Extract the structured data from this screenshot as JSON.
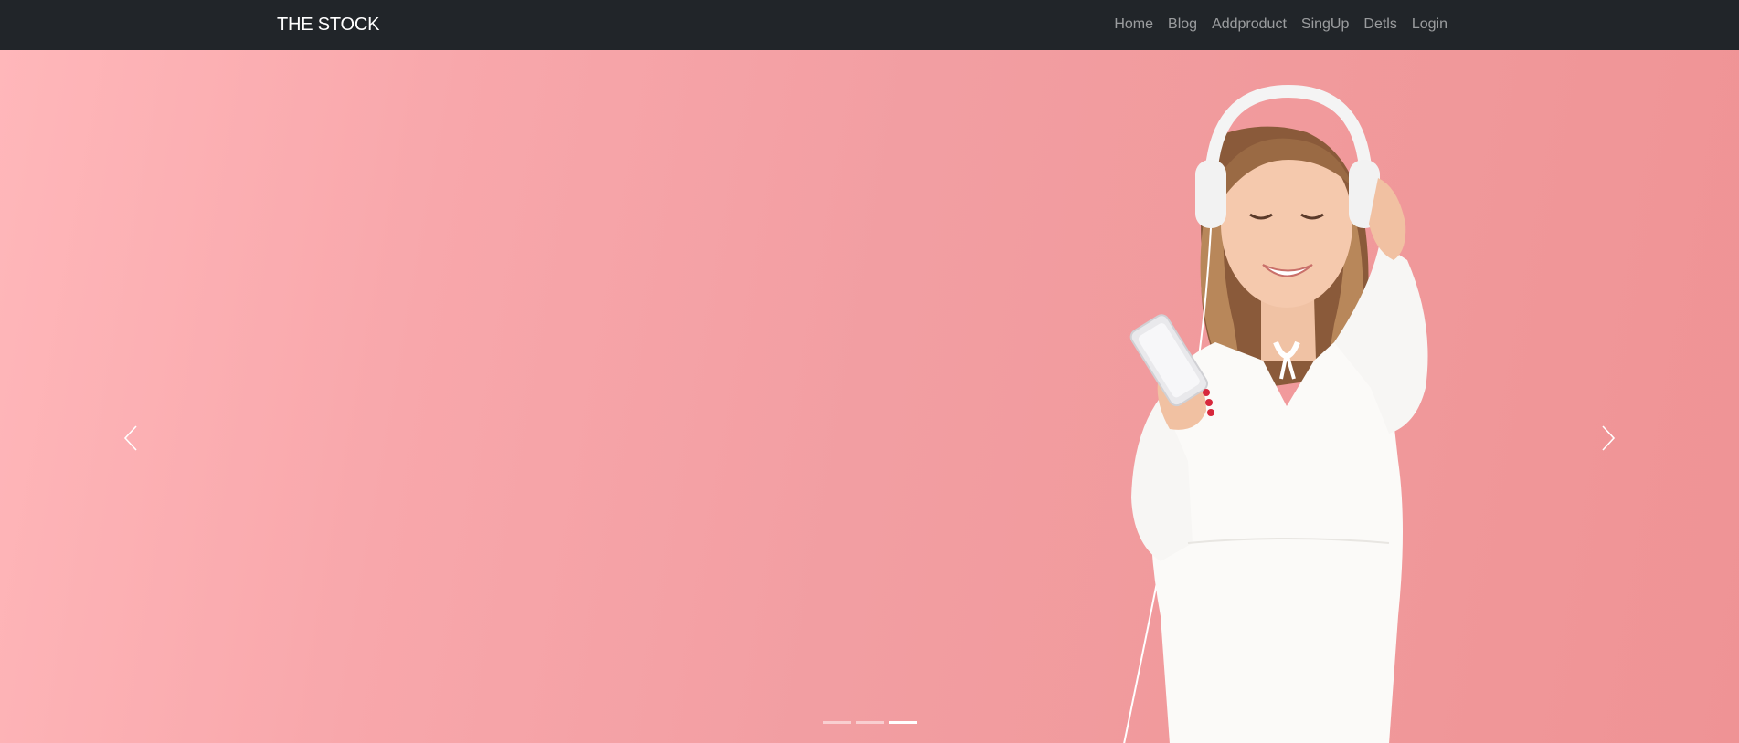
{
  "navbar": {
    "brand": "THE STOCK",
    "links": [
      {
        "label": "Home"
      },
      {
        "label": "Blog"
      },
      {
        "label": "Addproduct"
      },
      {
        "label": "SingUp"
      },
      {
        "label": "Detls"
      },
      {
        "label": "Login"
      }
    ]
  },
  "carousel": {
    "prev_icon": "chevron-left-icon",
    "next_icon": "chevron-right-icon",
    "indicator_count": 3,
    "active_indicator": 3
  },
  "colors": {
    "navbar_bg": "#212529",
    "hero_bg": "#f4a0a4",
    "nav_link": "rgba(255,255,255,0.55)"
  }
}
